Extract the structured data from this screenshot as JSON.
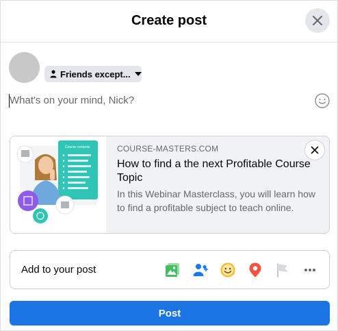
{
  "header": {
    "title": "Create post",
    "close_icon": "close-icon"
  },
  "user": {
    "name": "Nick",
    "avatar_color": "#c8c8c8"
  },
  "audience": {
    "label": "Friends except...",
    "icon": "person-icon",
    "caret_icon": "caret-down-icon"
  },
  "composer": {
    "placeholder": "What's on your mind, Nick?",
    "value": "",
    "emoji_icon": "smiley-icon"
  },
  "link_preview": {
    "domain": "COURSE-MASTERS.COM",
    "title": "How to find a the next Profitable Course Topic",
    "description": "In this Webinar Masterclass, you will learn how to find a profitable subject to teach online.",
    "thumbnail_panel_title": "Course contents",
    "close_icon": "close-icon"
  },
  "add_to_post": {
    "label": "Add to your post",
    "icons": [
      "photo-video-icon",
      "tag-people-icon",
      "feeling-activity-icon",
      "check-in-location-icon",
      "flag-icon",
      "more-icon"
    ]
  },
  "post_button": {
    "label": "Post"
  },
  "colors": {
    "accent": "#1b74e4",
    "photo_green": "#45bd62",
    "tag_blue": "#1877f2",
    "feeling_yellow": "#f7b928",
    "location_red": "#f5533d",
    "thumb_teal": "#2ec4b6",
    "thumb_purple": "#8e5ce6"
  }
}
